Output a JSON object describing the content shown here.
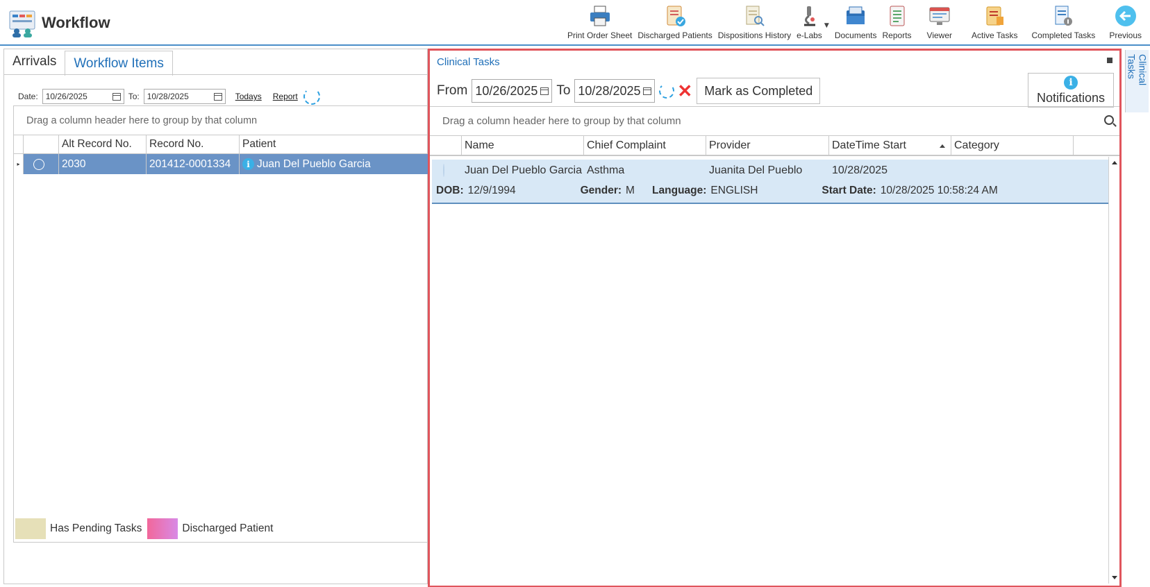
{
  "header": {
    "title": "Workflow"
  },
  "toolbar": {
    "items": [
      {
        "label": "Print Order Sheet",
        "icon": "printer-icon"
      },
      {
        "label": "Discharged Patients",
        "icon": "discharged-patients-icon"
      },
      {
        "label": "Dispositions History",
        "icon": "dispositions-history-icon"
      },
      {
        "label": "e-Labs",
        "icon": "microscope-icon"
      },
      {
        "label": "Documents",
        "icon": "documents-icon"
      },
      {
        "label": "Reports",
        "icon": "reports-icon"
      },
      {
        "label": "Viewer",
        "icon": "viewer-icon"
      },
      {
        "label": "Active Tasks",
        "icon": "active-tasks-icon"
      },
      {
        "label": "Completed Tasks",
        "icon": "completed-tasks-icon"
      },
      {
        "label": "Previous",
        "icon": "back-arrow-icon"
      }
    ]
  },
  "left": {
    "tabs": [
      {
        "label": "Arrivals"
      },
      {
        "label": "Workflow Items"
      }
    ],
    "filter": {
      "date_label": "Date:",
      "date_from": "10/26/2025",
      "to_label": "To:",
      "date_to": "10/28/2025",
      "todays_link": "Todays",
      "report_link": "Report"
    },
    "grid": {
      "group_hint": "Drag a column header here to group by that column",
      "columns": [
        "Alt Record No.",
        "Record No.",
        "Patient"
      ],
      "rows": [
        {
          "alt_record": "2030",
          "record": "201412-0001334",
          "patient": "Juan Del Pueblo Garcia"
        }
      ]
    },
    "legend": [
      {
        "label": "Has Pending Tasks",
        "color": "#e6e0b8"
      },
      {
        "label": "Discharged Patient",
        "color": "#e466b2"
      }
    ]
  },
  "clinical": {
    "title": "Clinical Tasks",
    "from_label": "From",
    "from_date": "10/26/2025",
    "to_label": "To",
    "to_date": "10/28/2025",
    "mark_completed": "Mark as Completed",
    "notifications": "Notifications",
    "group_hint": "Drag a column header here to group by that column",
    "columns": [
      "Name",
      "Chief Complaint",
      "Provider",
      "DateTime Start",
      "Category"
    ],
    "row": {
      "name": "Juan Del Pueblo Garcia",
      "complaint": "Asthma",
      "provider": "Juanita Del Pueblo",
      "start": "10/28/2025",
      "category": "",
      "dob_label": "DOB:",
      "dob": "12/9/1994",
      "gender_label": "Gender:",
      "gender": "M",
      "language_label": "Language:",
      "language": "ENGLISH",
      "start_date_label": "Start Date:",
      "start_date": "10/28/2025 10:58:24 AM"
    }
  },
  "side_tab": {
    "label": "Clinical Tasks"
  },
  "colors": {
    "accent": "#1f6fb8",
    "highlight_border": "#e0555c",
    "selected_row": "#6a93c6",
    "task_row": "#d8e8f6"
  }
}
